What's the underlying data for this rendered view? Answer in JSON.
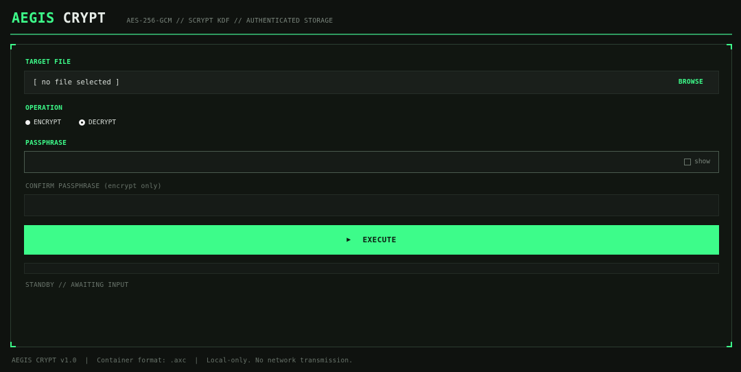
{
  "header": {
    "brand_primary": "AEGIS",
    "brand_secondary": "CRYPT",
    "tagline": "AES-256-GCM // SCRYPT KDF // AUTHENTICATED STORAGE"
  },
  "form": {
    "target_file": {
      "label": "TARGET FILE",
      "value": "[ no file selected ]",
      "browse_label": "BROWSE"
    },
    "operation": {
      "label": "OPERATION",
      "options": [
        "ENCRYPT",
        "DECRYPT"
      ],
      "selected": "DECRYPT"
    },
    "passphrase": {
      "label": "PASSPHRASE",
      "value": "",
      "show_label": "show",
      "show_checked": false
    },
    "confirm_passphrase": {
      "label": "CONFIRM PASSPHRASE (encrypt only)",
      "value": ""
    },
    "execute": {
      "icon": "play-icon",
      "label": "EXECUTE"
    },
    "progress": 0,
    "status": "STANDBY // AWAITING INPUT"
  },
  "footer": {
    "text": "AEGIS CRYPT v1.0  |  Container format: .axc  |  Local-only. No network transmission."
  },
  "colors": {
    "accent": "#3dfc8a",
    "background": "#0f120f"
  }
}
